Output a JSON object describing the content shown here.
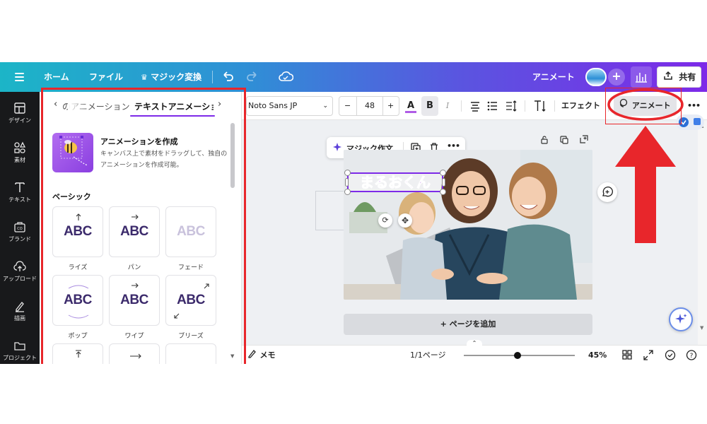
{
  "topbar": {
    "home": "ホーム",
    "file": "ファイル",
    "magic_switch": "マジック変換",
    "design_name": "アニメート",
    "share": "共有"
  },
  "rail": [
    {
      "label": "デザイン",
      "icon": "layout-icon"
    },
    {
      "label": "素材",
      "icon": "elements-icon"
    },
    {
      "label": "テキスト",
      "icon": "text-icon"
    },
    {
      "label": "ブランド",
      "icon": "brand-icon"
    },
    {
      "label": "アップロード",
      "icon": "upload-icon"
    },
    {
      "label": "描画",
      "icon": "draw-icon"
    },
    {
      "label": "プロジェクト",
      "icon": "folder-icon"
    }
  ],
  "panel": {
    "tab_prev": "のアニメーション",
    "tab_active": "テキストアニメーショ",
    "create_title": "アニメーションを作成",
    "create_desc": "キャンバス上で素材をドラッグして、独自のアニメーションを作成可能。",
    "section_basic": "ベーシック",
    "tiles": [
      {
        "text": "ABC",
        "label": "ライズ",
        "icon": "arrow-up-icon"
      },
      {
        "text": "ABC",
        "label": "パン",
        "icon": "arrow-right-icon"
      },
      {
        "text": "ABC",
        "label": "フェード",
        "icon": "fade-icon"
      },
      {
        "text": "ABC",
        "label": "ポップ",
        "icon": "pop-icon"
      },
      {
        "text": "ABC",
        "label": "ワイプ",
        "icon": "wipe-icon"
      },
      {
        "text": "ABC",
        "label": "ブリーズ",
        "icon": "breathe-icon"
      }
    ]
  },
  "toolbar": {
    "font": "Noto Sans JP",
    "size": "48",
    "minus": "−",
    "plus": "+",
    "bold": "B",
    "italic": "I",
    "effect": "エフェクト",
    "animate": "アニメート",
    "more": "•••"
  },
  "canvas": {
    "magic_write": "マジック作文",
    "text_element": "まるおくん",
    "add_page": "+ ページを追加"
  },
  "bottombar": {
    "memo": "メモ",
    "page": "1/1ページ",
    "zoom": "45%",
    "zoom_level": 0.45
  },
  "colors": {
    "accent": "#7d2ae8",
    "annotation_red": "#e8262b",
    "text_purple": "#b05ce6"
  }
}
